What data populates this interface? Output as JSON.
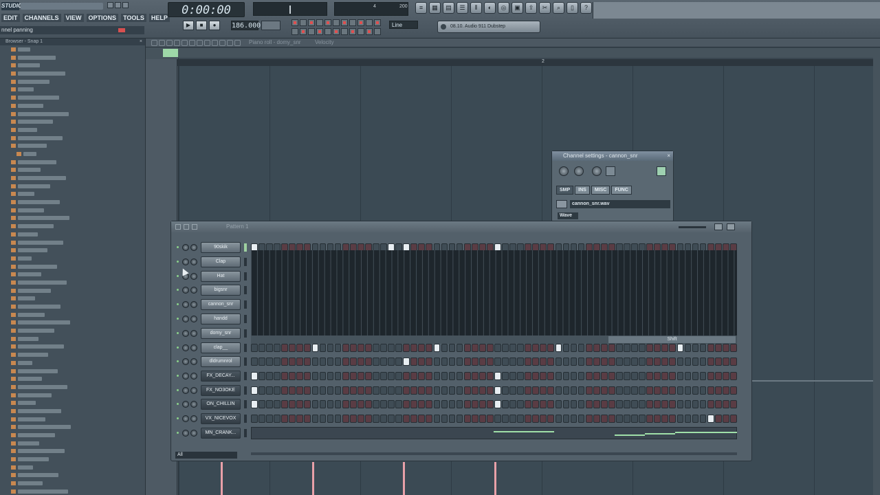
{
  "app": {
    "logo": "STUDIO",
    "menu": [
      "EDIT",
      "CHANNELS",
      "VIEW",
      "OPTIONS",
      "TOOLS",
      "HELP"
    ],
    "hint": "nnel panning",
    "time": "0:00:00",
    "tempo": "186.000",
    "meter_right": {
      "left": "4",
      "right": "200"
    },
    "line_mode": "Line",
    "song": "08.10. Audio 911 Dubstep"
  },
  "browser": {
    "title": "Browser - Snap 1",
    "item_count": 56
  },
  "pianoroll": {
    "title": "Piano roll - domy_snr",
    "mode": "Velocity",
    "bar_number": "2"
  },
  "channel_settings": {
    "title": "Channel settings - cannon_snr",
    "tabs": [
      "SMP",
      "INS",
      "MISC",
      "FUNC"
    ],
    "file": "cannon_snr.wav",
    "wave_label": "Wave"
  },
  "step_sequencer": {
    "title": "Pattern 1",
    "filter": "All",
    "swing_label": "Shift",
    "channels": [
      {
        "name": "90skik",
        "selected": true,
        "on": [
          0,
          18,
          20,
          32
        ],
        "alt": false
      },
      {
        "name": "Clap",
        "selected": false,
        "on": [],
        "alt": false
      },
      {
        "name": "Hat",
        "selected": false,
        "on": [],
        "alt": false
      },
      {
        "name": "bigsnr",
        "selected": false,
        "on": [],
        "alt": false
      },
      {
        "name": "cannon_snr",
        "selected": false,
        "on": [],
        "alt": false
      },
      {
        "name": "handd",
        "selected": false,
        "on": [],
        "alt": false
      },
      {
        "name": "domy_snr",
        "selected": false,
        "on": [],
        "alt": false
      },
      {
        "name": "clap__",
        "selected": false,
        "on": [
          8,
          24,
          40,
          56
        ],
        "alt": false
      },
      {
        "name": "dldrumnrol",
        "selected": false,
        "on": [
          20
        ],
        "alt": false
      },
      {
        "name": "FX_DECAY...",
        "selected": false,
        "on": [
          0,
          32
        ],
        "alt": true
      },
      {
        "name": "FX_NO3OKE",
        "selected": false,
        "on": [
          0,
          32
        ],
        "alt": true
      },
      {
        "name": "ON_CHILLIN",
        "selected": false,
        "on": [
          0,
          32
        ],
        "alt": true
      },
      {
        "name": "VX_NICEVOX",
        "selected": false,
        "on": [
          60
        ],
        "alt": true
      },
      {
        "name": "MN_CRANK...",
        "selected": false,
        "on": [],
        "alt": true
      }
    ]
  },
  "colors": {
    "accent": "#9ed0a0",
    "step_on": "#e8eef2",
    "marker": "#e8a0a8"
  }
}
